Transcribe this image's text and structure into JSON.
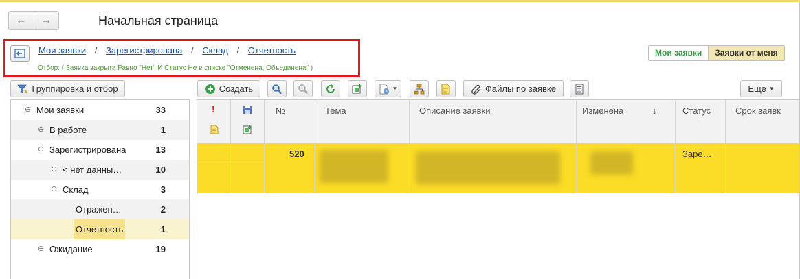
{
  "header": {
    "nav_back": "←",
    "nav_forward": "→",
    "title": "Начальная страница"
  },
  "breadcrumbs": [
    "Мои заявки",
    "Зарегистрирована",
    "Склад",
    "Отчетность"
  ],
  "breadcrumb_separator": "/",
  "filter_text": "Отбор:  ( Заявка закрыта Равно \"Нет\" И Статус Не в списке \"Отменена; Объединена\" )",
  "view_switch": {
    "mine": "Мои заявки",
    "from_me": "Заявки от меня"
  },
  "toolbar": {
    "group_filter": "Группировка и отбор",
    "create": "Создать",
    "files": "Файлы по заявке",
    "more": "Еще"
  },
  "tree": [
    {
      "expander": "⊖",
      "label": "Мои заявки",
      "count": "33"
    },
    {
      "expander": "⊕",
      "label": "В работе",
      "count": "1"
    },
    {
      "expander": "⊖",
      "label": "Зарегистрирована",
      "count": "13"
    },
    {
      "expander": "⊕",
      "label": "< нет данны…",
      "count": "10"
    },
    {
      "expander": "⊖",
      "label": "Склад",
      "count": "3"
    },
    {
      "expander": "",
      "label": "Отражен…",
      "count": "2"
    },
    {
      "expander": "",
      "label": "Отчетность",
      "count": "1"
    },
    {
      "expander": "⊕",
      "label": "Ожидание",
      "count": "19"
    }
  ],
  "table": {
    "columns": {
      "important": "!",
      "number": "№",
      "subject": "Тема",
      "description": "Описание заявки",
      "changed": "Изменена",
      "sort_mark": "↓",
      "status": "Статус",
      "due": "Срок заявк"
    },
    "rows": [
      {
        "number": "520",
        "status": "Заре…"
      }
    ]
  },
  "colors": {
    "accent_row": "#fbdc26",
    "filter_highlight": "#e2161e",
    "filter_text": "#4a9e33",
    "link": "#1c4ea0"
  }
}
